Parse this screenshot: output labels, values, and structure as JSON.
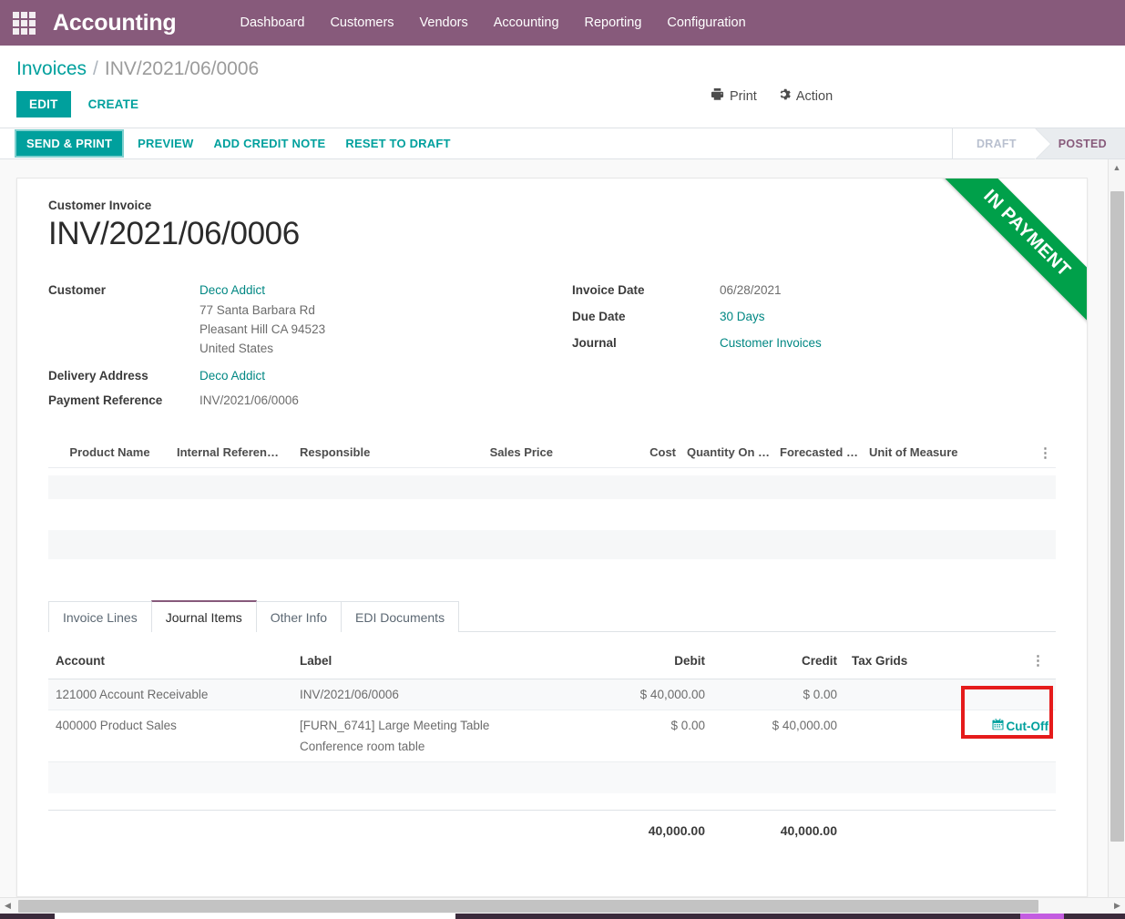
{
  "navbar": {
    "apps_icon": "apps-grid-icon",
    "brand": "Accounting",
    "menu": [
      {
        "label": "Dashboard"
      },
      {
        "label": "Customers"
      },
      {
        "label": "Vendors"
      },
      {
        "label": "Accounting"
      },
      {
        "label": "Reporting"
      },
      {
        "label": "Configuration"
      }
    ],
    "bg_color": "#875A7B"
  },
  "control_panel": {
    "breadcrumb": {
      "root": "Invoices",
      "separator": "/",
      "current": "INV/2021/06/0006"
    },
    "edit_label": "EDIT",
    "create_label": "CREATE",
    "print_label": "Print",
    "print_icon": "printer-icon",
    "action_label": "Action",
    "action_icon": "gear-icon"
  },
  "statusbar": {
    "buttons": [
      {
        "label": "SEND & PRINT",
        "primary": true
      },
      {
        "label": "PREVIEW",
        "primary": false
      },
      {
        "label": "ADD CREDIT NOTE",
        "primary": false
      },
      {
        "label": "RESET TO DRAFT",
        "primary": false
      }
    ],
    "stages": [
      {
        "label": "DRAFT",
        "active": false
      },
      {
        "label": "POSTED",
        "active": true
      }
    ]
  },
  "sheet": {
    "ribbon": "IN PAYMENT",
    "ribbon_color": "#00A04A",
    "subtitle": "Customer Invoice",
    "title": "INV/2021/06/0006",
    "left_fields": {
      "customer_label": "Customer",
      "customer_name": "Deco Addict",
      "customer_address": [
        "77 Santa Barbara Rd",
        "Pleasant Hill CA 94523",
        "United States"
      ],
      "delivery_address_label": "Delivery Address",
      "delivery_address_value": "Deco Addict",
      "payment_reference_label": "Payment Reference",
      "payment_reference_value": "INV/2021/06/0006"
    },
    "right_fields": [
      {
        "label": "Invoice Date",
        "value": "06/28/2021",
        "link": false
      },
      {
        "label": "Due Date",
        "value": "30 Days",
        "link": true
      },
      {
        "label": "Journal",
        "value": "Customer Invoices",
        "link": true
      }
    ]
  },
  "product_table": {
    "columns": [
      "Product Name",
      "Internal Referen…",
      "Responsible",
      "Sales Price",
      "Cost",
      "Quantity On …",
      "Forecasted …",
      "Unit of Measure"
    ],
    "options_icon": "vertical-dots-icon"
  },
  "notebook": {
    "tabs": [
      {
        "label": "Invoice Lines",
        "active": false
      },
      {
        "label": "Journal Items",
        "active": true
      },
      {
        "label": "Other Info",
        "active": false
      },
      {
        "label": "EDI Documents",
        "active": false
      }
    ]
  },
  "journal_items": {
    "columns": [
      "Account",
      "Label",
      "Debit",
      "Credit",
      "Tax Grids"
    ],
    "options_icon": "vertical-dots-icon",
    "rows": [
      {
        "account": "121000 Account Receivable",
        "label": "INV/2021/06/0006",
        "label_line2": "",
        "debit": "$ 40,000.00",
        "credit": "$ 0.00",
        "tax_grids": "",
        "cutoff": ""
      },
      {
        "account": "400000 Product Sales",
        "label": "[FURN_6741] Large Meeting Table",
        "label_line2": "Conference room table",
        "debit": "$ 0.00",
        "credit": "$ 40,000.00",
        "tax_grids": "",
        "cutoff": "Cut-Off"
      }
    ],
    "cutoff_icon": "calendar-icon",
    "totals": {
      "debit": "40,000.00",
      "credit": "40,000.00"
    }
  },
  "annotation": {
    "highlight_color": "#e51b1b"
  },
  "scrollbars": {
    "vertical_up_icon": "triangle-up-icon",
    "vertical_down_icon": "triangle-down-icon",
    "horizontal_left_icon": "triangle-left-icon",
    "horizontal_right_icon": "triangle-right-icon"
  }
}
